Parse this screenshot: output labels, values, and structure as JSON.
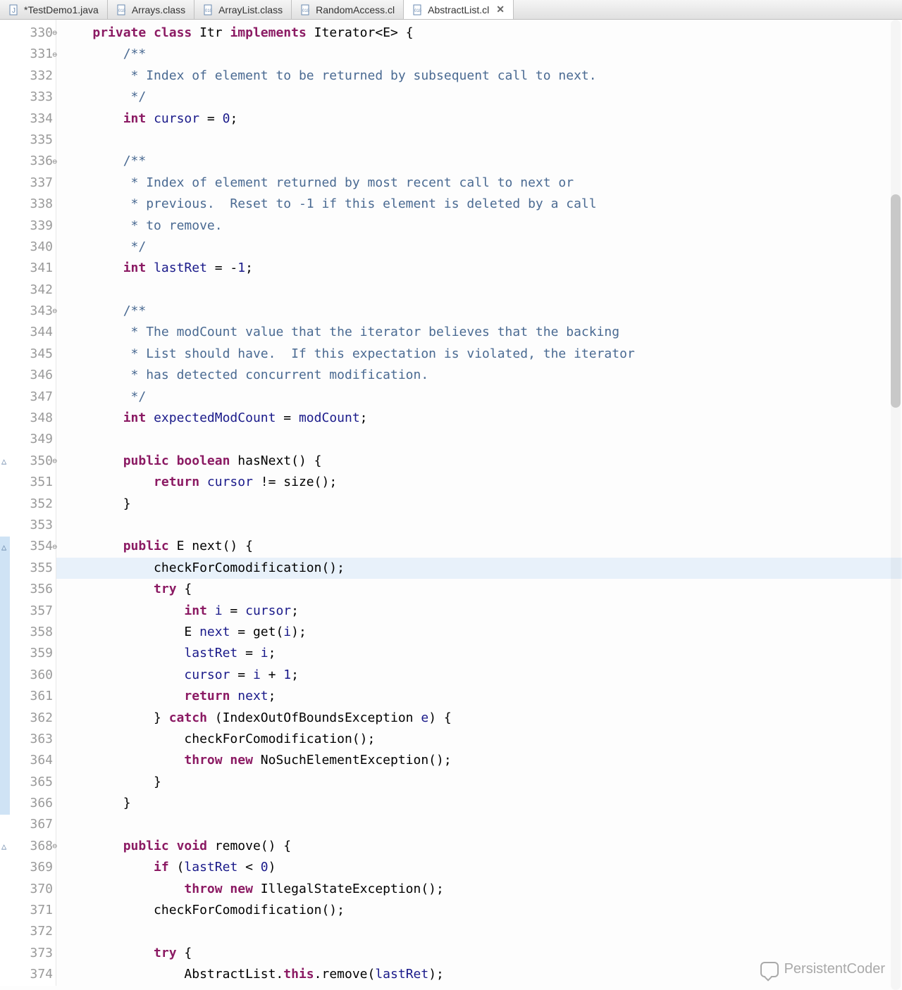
{
  "tabs": [
    {
      "label": "*TestDemo1.java",
      "icon": "java-file-icon",
      "closeable": false
    },
    {
      "label": "Arrays.class",
      "icon": "class-file-icon",
      "closeable": false
    },
    {
      "label": "ArrayList.class",
      "icon": "class-file-icon",
      "closeable": false
    },
    {
      "label": "RandomAccess.cl",
      "icon": "class-file-icon",
      "closeable": false
    },
    {
      "label": "AbstractList.cl",
      "icon": "class-file-icon",
      "closeable": true,
      "active": true
    }
  ],
  "gutter": {
    "start": 330,
    "end": 374,
    "collapsible": [
      330,
      331,
      336,
      343,
      350,
      354,
      368
    ],
    "override_markers": [
      350,
      354,
      368
    ],
    "highlight_block_start": 354,
    "highlight_block_end": 366
  },
  "highlighted_line": 355,
  "code_lines": [
    {
      "n": 330,
      "tokens": [
        [
          "    ",
          ""
        ],
        [
          "private",
          "kw"
        ],
        [
          " ",
          ""
        ],
        [
          "class",
          "kw"
        ],
        [
          " Itr ",
          ""
        ],
        [
          "implements",
          "kw"
        ],
        [
          " Iterator<E> {",
          ""
        ]
      ]
    },
    {
      "n": 331,
      "tokens": [
        [
          "        ",
          ""
        ],
        [
          "/**",
          "comment"
        ]
      ]
    },
    {
      "n": 332,
      "tokens": [
        [
          "         ",
          ""
        ],
        [
          "* Index of element to be returned by subsequent call to next.",
          "comment"
        ]
      ]
    },
    {
      "n": 333,
      "tokens": [
        [
          "         ",
          ""
        ],
        [
          "*/",
          "comment"
        ]
      ]
    },
    {
      "n": 334,
      "tokens": [
        [
          "        ",
          ""
        ],
        [
          "int",
          "kw"
        ],
        [
          " ",
          ""
        ],
        [
          "cursor",
          "field"
        ],
        [
          " = ",
          ""
        ],
        [
          "0",
          "num"
        ],
        [
          ";",
          ""
        ]
      ]
    },
    {
      "n": 335,
      "tokens": [
        [
          "",
          ""
        ]
      ]
    },
    {
      "n": 336,
      "tokens": [
        [
          "        ",
          ""
        ],
        [
          "/**",
          "comment"
        ]
      ]
    },
    {
      "n": 337,
      "tokens": [
        [
          "         ",
          ""
        ],
        [
          "* Index of element returned by most recent call to next or",
          "comment"
        ]
      ]
    },
    {
      "n": 338,
      "tokens": [
        [
          "         ",
          ""
        ],
        [
          "* previous.  Reset to -1 if this element is deleted by a call",
          "comment"
        ]
      ]
    },
    {
      "n": 339,
      "tokens": [
        [
          "         ",
          ""
        ],
        [
          "* to remove.",
          "comment"
        ]
      ]
    },
    {
      "n": 340,
      "tokens": [
        [
          "         ",
          ""
        ],
        [
          "*/",
          "comment"
        ]
      ]
    },
    {
      "n": 341,
      "tokens": [
        [
          "        ",
          ""
        ],
        [
          "int",
          "kw"
        ],
        [
          " ",
          ""
        ],
        [
          "lastRet",
          "field"
        ],
        [
          " = -",
          ""
        ],
        [
          "1",
          "num"
        ],
        [
          ";",
          ""
        ]
      ]
    },
    {
      "n": 342,
      "tokens": [
        [
          "",
          ""
        ]
      ]
    },
    {
      "n": 343,
      "tokens": [
        [
          "        ",
          ""
        ],
        [
          "/**",
          "comment"
        ]
      ]
    },
    {
      "n": 344,
      "tokens": [
        [
          "         ",
          ""
        ],
        [
          "* The modCount value that the iterator believes that the backing",
          "comment"
        ]
      ]
    },
    {
      "n": 345,
      "tokens": [
        [
          "         ",
          ""
        ],
        [
          "* List should have.  If this expectation is violated, the iterator",
          "comment"
        ]
      ]
    },
    {
      "n": 346,
      "tokens": [
        [
          "         ",
          ""
        ],
        [
          "* has detected concurrent modification.",
          "comment"
        ]
      ]
    },
    {
      "n": 347,
      "tokens": [
        [
          "         ",
          ""
        ],
        [
          "*/",
          "comment"
        ]
      ]
    },
    {
      "n": 348,
      "tokens": [
        [
          "        ",
          ""
        ],
        [
          "int",
          "kw"
        ],
        [
          " ",
          ""
        ],
        [
          "expectedModCount",
          "field"
        ],
        [
          " = ",
          ""
        ],
        [
          "modCount",
          "ref"
        ],
        [
          ";",
          ""
        ]
      ]
    },
    {
      "n": 349,
      "tokens": [
        [
          "",
          ""
        ]
      ]
    },
    {
      "n": 350,
      "tokens": [
        [
          "        ",
          ""
        ],
        [
          "public",
          "kw"
        ],
        [
          " ",
          ""
        ],
        [
          "boolean",
          "kw"
        ],
        [
          " hasNext() {",
          ""
        ]
      ]
    },
    {
      "n": 351,
      "tokens": [
        [
          "            ",
          ""
        ],
        [
          "return",
          "kw"
        ],
        [
          " ",
          ""
        ],
        [
          "cursor",
          "field"
        ],
        [
          " != size();",
          ""
        ]
      ]
    },
    {
      "n": 352,
      "tokens": [
        [
          "        }",
          ""
        ]
      ]
    },
    {
      "n": 353,
      "tokens": [
        [
          "",
          ""
        ]
      ]
    },
    {
      "n": 354,
      "tokens": [
        [
          "        ",
          ""
        ],
        [
          "public",
          "kw"
        ],
        [
          " E next() {",
          ""
        ]
      ]
    },
    {
      "n": 355,
      "tokens": [
        [
          "            checkForComodification();",
          ""
        ]
      ]
    },
    {
      "n": 356,
      "tokens": [
        [
          "            ",
          ""
        ],
        [
          "try",
          "kw"
        ],
        [
          " {",
          ""
        ]
      ]
    },
    {
      "n": 357,
      "tokens": [
        [
          "                ",
          ""
        ],
        [
          "int",
          "kw"
        ],
        [
          " ",
          ""
        ],
        [
          "i",
          "field"
        ],
        [
          " = ",
          ""
        ],
        [
          "cursor",
          "field"
        ],
        [
          ";",
          ""
        ]
      ]
    },
    {
      "n": 358,
      "tokens": [
        [
          "                E ",
          ""
        ],
        [
          "next",
          "field"
        ],
        [
          " = get(",
          ""
        ],
        [
          "i",
          "field"
        ],
        [
          ");",
          ""
        ]
      ]
    },
    {
      "n": 359,
      "tokens": [
        [
          "                ",
          ""
        ],
        [
          "lastRet",
          "field"
        ],
        [
          " = ",
          ""
        ],
        [
          "i",
          "field"
        ],
        [
          ";",
          ""
        ]
      ]
    },
    {
      "n": 360,
      "tokens": [
        [
          "                ",
          ""
        ],
        [
          "cursor",
          "field"
        ],
        [
          " = ",
          ""
        ],
        [
          "i",
          "field"
        ],
        [
          " + ",
          ""
        ],
        [
          "1",
          "num"
        ],
        [
          ";",
          ""
        ]
      ]
    },
    {
      "n": 361,
      "tokens": [
        [
          "                ",
          ""
        ],
        [
          "return",
          "kw"
        ],
        [
          " ",
          ""
        ],
        [
          "next",
          "field"
        ],
        [
          ";",
          ""
        ]
      ]
    },
    {
      "n": 362,
      "tokens": [
        [
          "            } ",
          ""
        ],
        [
          "catch",
          "kw"
        ],
        [
          " (IndexOutOfBoundsException ",
          ""
        ],
        [
          "e",
          "field"
        ],
        [
          ") {",
          ""
        ]
      ]
    },
    {
      "n": 363,
      "tokens": [
        [
          "                checkForComodification();",
          ""
        ]
      ]
    },
    {
      "n": 364,
      "tokens": [
        [
          "                ",
          ""
        ],
        [
          "throw",
          "kw"
        ],
        [
          " ",
          ""
        ],
        [
          "new",
          "kw"
        ],
        [
          " NoSuchElementException();",
          ""
        ]
      ]
    },
    {
      "n": 365,
      "tokens": [
        [
          "            }",
          ""
        ]
      ]
    },
    {
      "n": 366,
      "tokens": [
        [
          "        }",
          ""
        ]
      ]
    },
    {
      "n": 367,
      "tokens": [
        [
          "",
          ""
        ]
      ]
    },
    {
      "n": 368,
      "tokens": [
        [
          "        ",
          ""
        ],
        [
          "public",
          "kw"
        ],
        [
          " ",
          ""
        ],
        [
          "void",
          "kw"
        ],
        [
          " remove() {",
          ""
        ]
      ]
    },
    {
      "n": 369,
      "tokens": [
        [
          "            ",
          ""
        ],
        [
          "if",
          "kw"
        ],
        [
          " (",
          ""
        ],
        [
          "lastRet",
          "field"
        ],
        [
          " < ",
          ""
        ],
        [
          "0",
          "num"
        ],
        [
          ")",
          ""
        ]
      ]
    },
    {
      "n": 370,
      "tokens": [
        [
          "                ",
          ""
        ],
        [
          "throw",
          "kw"
        ],
        [
          " ",
          ""
        ],
        [
          "new",
          "kw"
        ],
        [
          " IllegalStateException();",
          ""
        ]
      ]
    },
    {
      "n": 371,
      "tokens": [
        [
          "            checkForComodification();",
          ""
        ]
      ]
    },
    {
      "n": 372,
      "tokens": [
        [
          "",
          ""
        ]
      ]
    },
    {
      "n": 373,
      "tokens": [
        [
          "            ",
          ""
        ],
        [
          "try",
          "kw"
        ],
        [
          " {",
          ""
        ]
      ]
    },
    {
      "n": 374,
      "tokens": [
        [
          "                AbstractList.",
          ""
        ],
        [
          "this",
          "kw"
        ],
        [
          ".remove(",
          ""
        ],
        [
          "lastRet",
          "field"
        ],
        [
          ");",
          ""
        ]
      ]
    }
  ],
  "watermark": "PersistentCoder"
}
